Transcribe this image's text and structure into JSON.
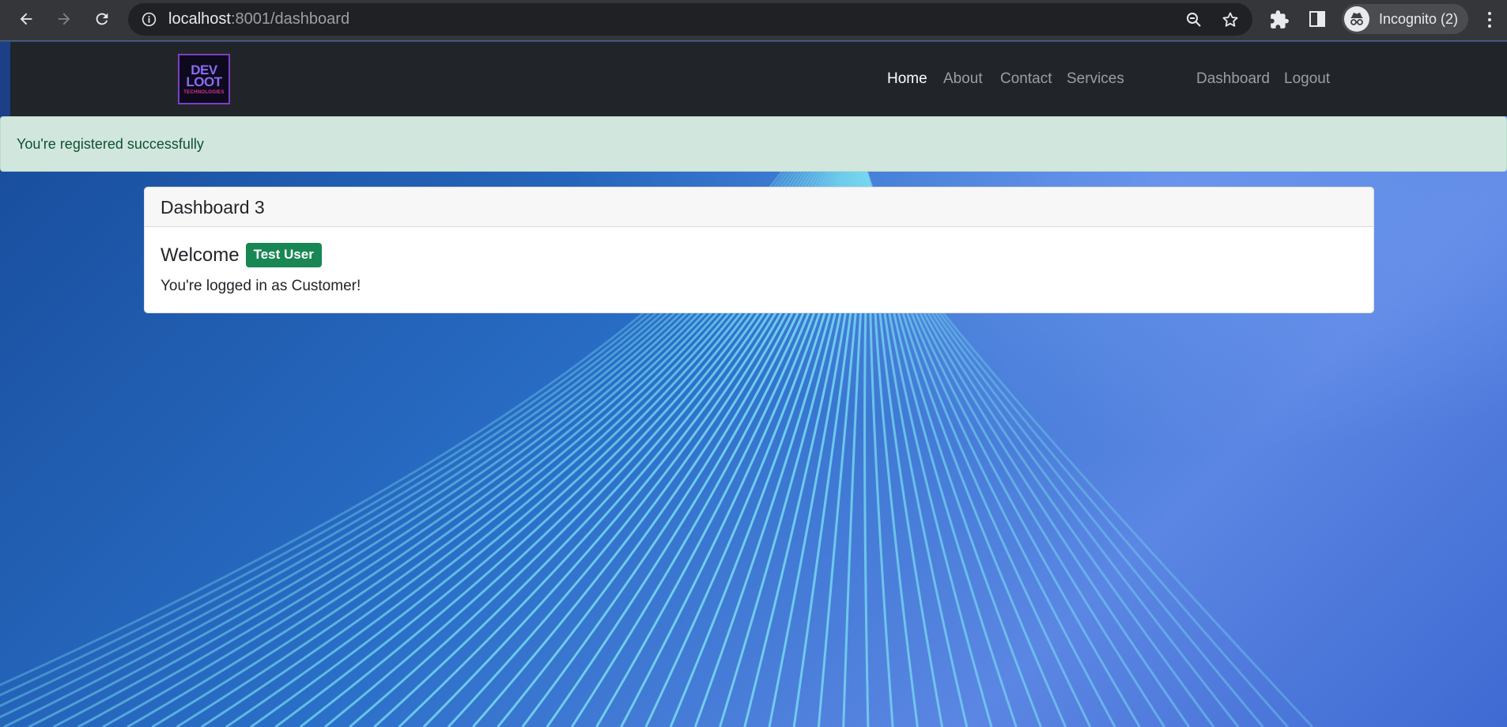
{
  "browser": {
    "url_host": "localhost",
    "url_path": ":8001/dashboard",
    "profile_label": "Incognito (2)",
    "icons": {
      "back": "back-arrow-icon",
      "forward": "forward-arrow-icon",
      "reload": "reload-icon",
      "site_info": "info-icon",
      "zoom": "zoom-out-icon",
      "bookmark": "star-icon",
      "extensions": "puzzle-icon",
      "side_panel": "side-panel-icon",
      "incognito": "incognito-icon",
      "menu": "kebab-menu-icon"
    }
  },
  "navbar": {
    "logo": {
      "line1": "DEV",
      "line2": "LOOT",
      "line3": "TECHNOLOGIES"
    },
    "links": [
      "Home",
      "About",
      "Contact",
      "Services"
    ],
    "active": "Home",
    "right_links": [
      "Dashboard",
      "Logout"
    ]
  },
  "alert": {
    "message": "You're registered successfully",
    "color": "#d1e7dd"
  },
  "card": {
    "header": "Dashboard 3",
    "welcome": "Welcome",
    "user_badge": "Test User",
    "role_message": "You're logged in as Customer!"
  },
  "colors": {
    "navbar_bg": "#212529",
    "badge_green": "#198754",
    "alert_text": "#0f5132"
  }
}
